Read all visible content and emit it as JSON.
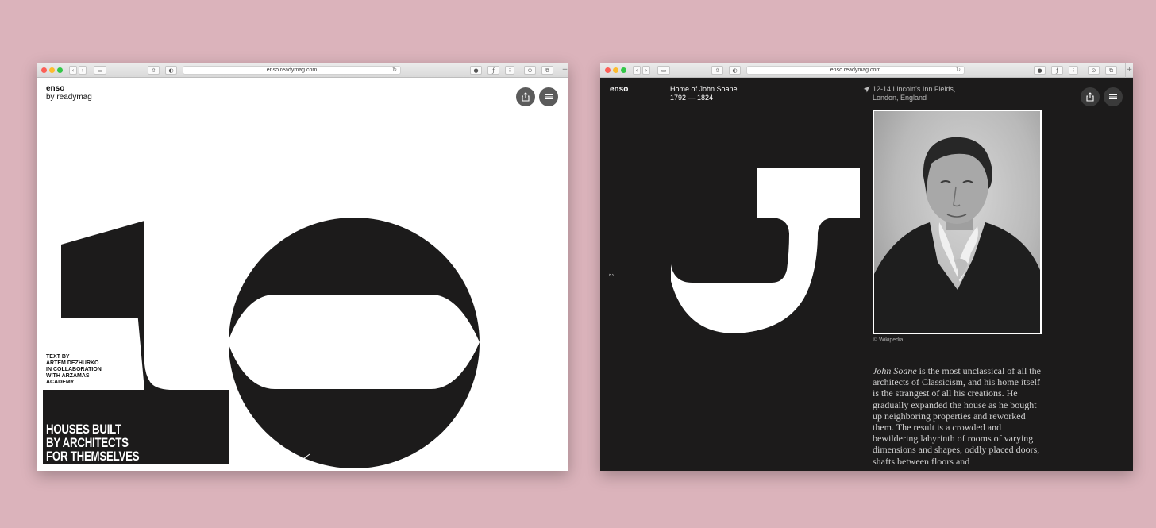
{
  "left_window": {
    "url": "enso.readymag.com",
    "logo": "enso",
    "logo_sub": "by readymag",
    "big_number": "10",
    "credits": [
      "TEXT BY",
      "ARTEM DEZHURKO",
      "IN COLLABORATION",
      "WITH ARZAMAS",
      "ACADEMY"
    ],
    "title_lines": [
      "HOUSES BUILT",
      "BY ARCHITECTS",
      "FOR THEMSELVES"
    ],
    "icons": {
      "share": "share-icon",
      "menu": "hamburger-menu-icon"
    }
  },
  "right_window": {
    "url": "enso.readymag.com",
    "logo": "enso",
    "heading": "Home of John Soane",
    "years": "1792 — 1824",
    "address_lines": [
      "12-14 Lincoln’s Inn Fields,",
      "London, England"
    ],
    "page_number": "2",
    "big_letter": "J",
    "caption": "© Wikipedia",
    "body_lead": "John Soane",
    "body_text": " is the most unclassical of all the architects of Classicism, and his home itself is the strangest of all his creations. He gradually expanded the house as he bought up neighboring properties and reworked them. The result is a crowded and bewildering labyrinth of rooms of varying dimensions and shapes, oddly placed doors, shafts between floors and"
  },
  "colors": {
    "background": "#dbb3bb",
    "ink": "#1c1b1b",
    "paper": "#ffffff"
  }
}
